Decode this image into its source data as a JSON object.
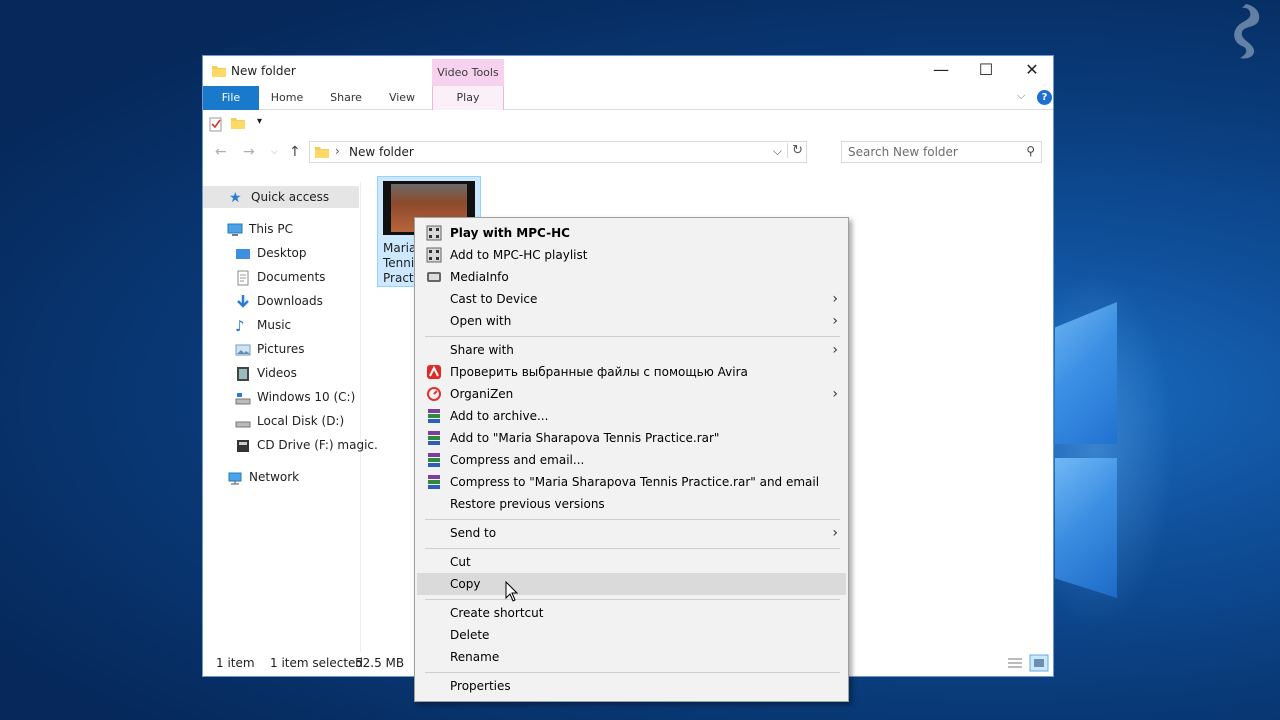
{
  "window": {
    "title": "New folder",
    "context_tab_header": "Video Tools",
    "min_glyph": "—",
    "max_glyph": "☐",
    "close_glyph": "✕"
  },
  "ribbon": {
    "tabs": [
      "File",
      "Home",
      "Share",
      "View",
      "Play"
    ],
    "help_glyph": "?"
  },
  "address": {
    "path": "New folder",
    "separator": "›"
  },
  "search": {
    "placeholder": "Search New folder"
  },
  "nav": {
    "quick_access": "Quick access",
    "this_pc": "This PC",
    "items": [
      "Desktop",
      "Documents",
      "Downloads",
      "Music",
      "Pictures",
      "Videos",
      "Windows 10 (C:)",
      "Local Disk (D:)",
      "CD Drive (F:) magic."
    ],
    "network": "Network"
  },
  "file": {
    "name_lines": [
      "Maria",
      "Tennis",
      "Practi"
    ]
  },
  "status": {
    "count": "1 item",
    "selected": "1 item selected",
    "size": "52.5 MB"
  },
  "context_menu": {
    "items": [
      {
        "label": "Play with MPC-HC",
        "icon": "mpc-icon",
        "bold": true
      },
      {
        "label": "Add to MPC-HC playlist",
        "icon": "mpc-icon"
      },
      {
        "label": "MediaInfo",
        "icon": "mediainfo-icon"
      },
      {
        "label": "Cast to Device",
        "submenu": true
      },
      {
        "label": "Open with",
        "submenu": true
      },
      {
        "label": "Share with",
        "submenu": true
      },
      {
        "label": "Проверить выбранные файлы с помощью Avira",
        "icon": "avira-icon"
      },
      {
        "label": "OrganiZen",
        "icon": "organizen-icon",
        "submenu": true
      },
      {
        "label": "Add to archive...",
        "icon": "winrar-icon"
      },
      {
        "label": "Add to \"Maria Sharapova Tennis Practice.rar\"",
        "icon": "winrar-icon"
      },
      {
        "label": "Compress and email...",
        "icon": "winrar-icon"
      },
      {
        "label": "Compress to \"Maria Sharapova Tennis Practice.rar\" and email",
        "icon": "winrar-icon"
      },
      {
        "label": "Restore previous versions"
      },
      {
        "label": "Send to",
        "submenu": true
      },
      {
        "label": "Cut"
      },
      {
        "label": "Copy",
        "highlighted": true
      },
      {
        "label": "Create shortcut"
      },
      {
        "label": "Delete"
      },
      {
        "label": "Rename"
      },
      {
        "label": "Properties"
      }
    ]
  },
  "colors": {
    "accent": "#1979ca",
    "context_tab": "#f6d2ee",
    "selection": "#cce8ff",
    "menu_bg": "#f2f2f2"
  }
}
